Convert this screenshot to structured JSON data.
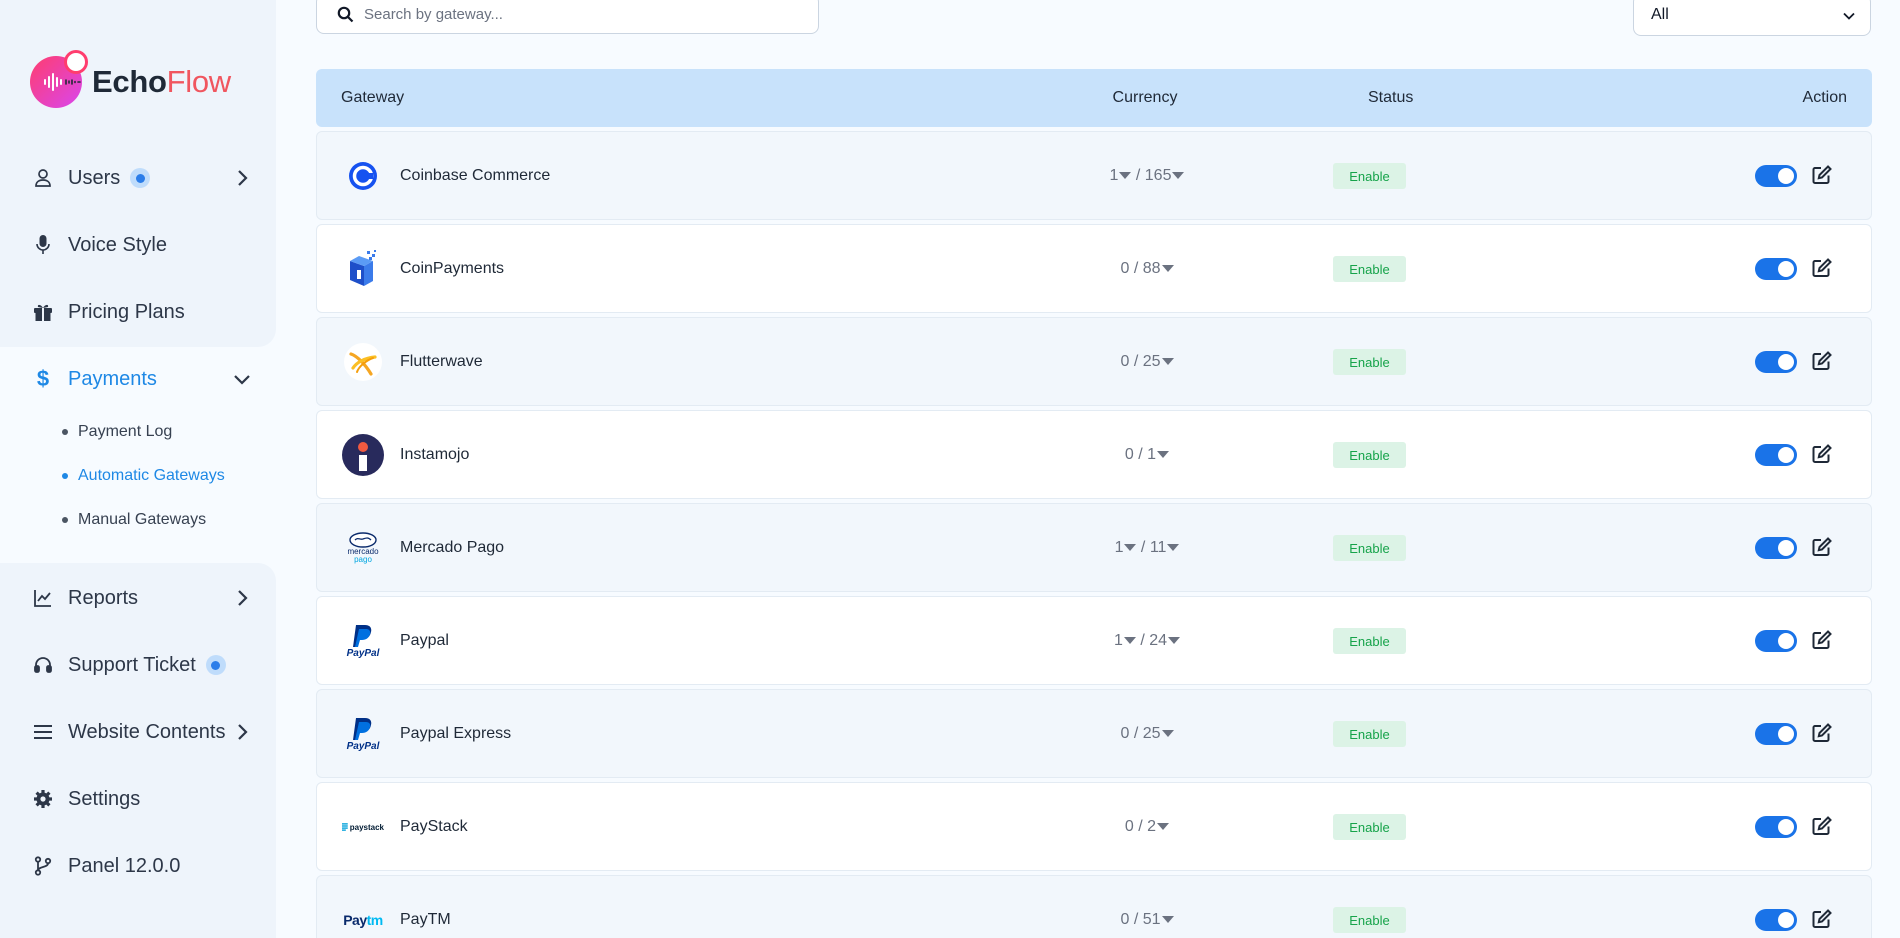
{
  "app": {
    "logo_text_a": "Echo",
    "logo_text_b": "Flow",
    "colors": {
      "accent": "#1a73e8",
      "brand_a": "#1f2937",
      "brand_b": "#f0565f",
      "status_bg": "#dcf3e6",
      "status_text": "#16a34a",
      "table_header": "#c8e2fb"
    }
  },
  "sidebar": {
    "users": "Users",
    "voice_style": "Voice Style",
    "pricing_plans": "Pricing Plans",
    "payments": "Payments",
    "payment_log": "Payment Log",
    "automatic_gateways": "Automatic Gateways",
    "manual_gateways": "Manual Gateways",
    "reports": "Reports",
    "support_ticket": "Support Ticket",
    "website_contents": "Website Contents",
    "settings": "Settings",
    "panel": "Panel 12.0.0"
  },
  "search": {
    "placeholder": "Search by gateway..."
  },
  "filter": {
    "selected": "All"
  },
  "table": {
    "headers": {
      "gateway": "Gateway",
      "currency": "Currency",
      "status": "Status",
      "action": "Action"
    },
    "rows": [
      {
        "name": "Coinbase Commerce",
        "cur_a": "1",
        "cur_b": "165",
        "status": "Enable",
        "icon": "coinbase-icon"
      },
      {
        "name": "CoinPayments",
        "cur_a": "0",
        "cur_b": "88",
        "status": "Enable",
        "icon": "coinpayments-icon"
      },
      {
        "name": "Flutterwave",
        "cur_a": "0",
        "cur_b": "25",
        "status": "Enable",
        "icon": "flutterwave-icon"
      },
      {
        "name": "Instamojo",
        "cur_a": "0",
        "cur_b": "1",
        "status": "Enable",
        "icon": "instamojo-icon"
      },
      {
        "name": "Mercado Pago",
        "cur_a": "1",
        "cur_b": "11",
        "status": "Enable",
        "icon": "mercadopago-icon"
      },
      {
        "name": "Paypal",
        "cur_a": "1",
        "cur_b": "24",
        "status": "Enable",
        "icon": "paypal-icon"
      },
      {
        "name": "Paypal Express",
        "cur_a": "0",
        "cur_b": "25",
        "status": "Enable",
        "icon": "paypal-icon"
      },
      {
        "name": "PayStack",
        "cur_a": "0",
        "cur_b": "2",
        "status": "Enable",
        "icon": "paystack-icon"
      },
      {
        "name": "PayTM",
        "cur_a": "0",
        "cur_b": "51",
        "status": "Enable",
        "icon": "paytm-icon"
      }
    ],
    "logo_labels": {
      "mercado": "mercado",
      "pago": "pago",
      "paystack": "paystack",
      "paytm_a": "Pay",
      "paytm_b": "tm",
      "paypal_text": "PayPal"
    }
  }
}
